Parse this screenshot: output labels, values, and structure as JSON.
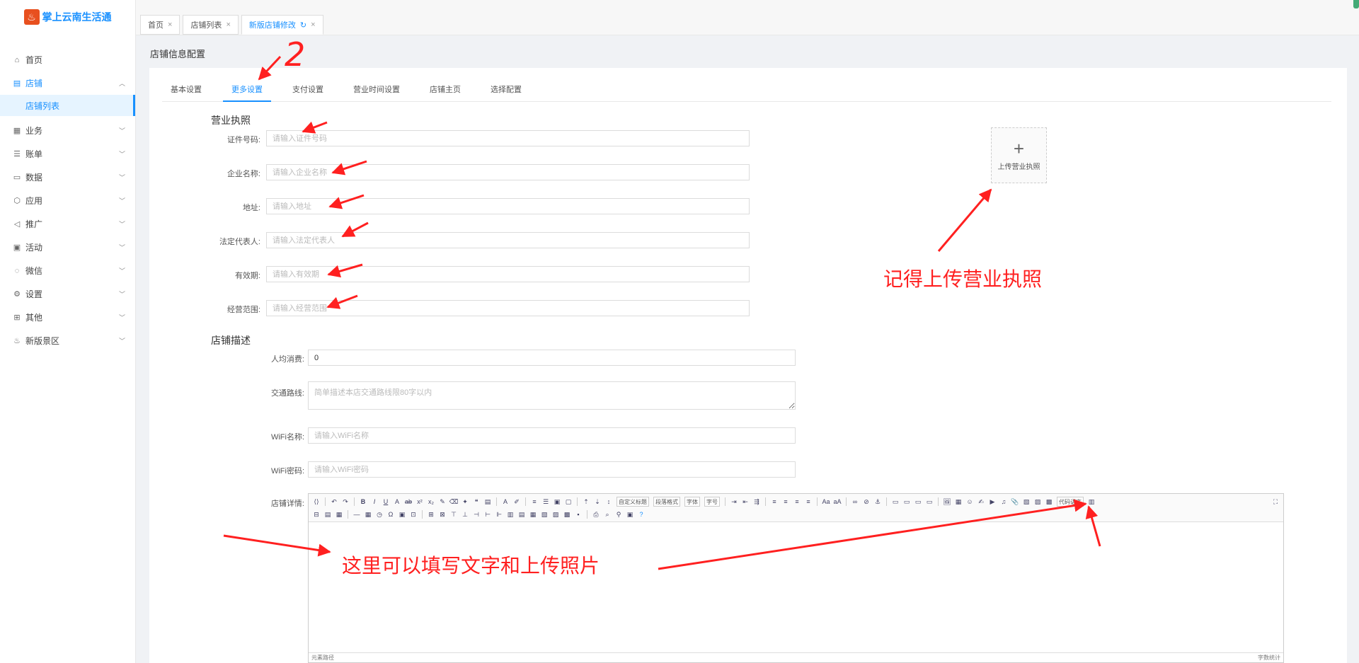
{
  "app": {
    "logo_text": "掌上云南生活通",
    "logo_icon": "flame-logo-icon"
  },
  "sidebar": {
    "items": [
      {
        "label": "首页",
        "icon": "home-icon"
      },
      {
        "label": "店铺",
        "icon": "shop-icon",
        "active": true,
        "expanded": true
      },
      {
        "label": "业务",
        "icon": "business-icon"
      },
      {
        "label": "账单",
        "icon": "bill-icon"
      },
      {
        "label": "数据",
        "icon": "data-icon"
      },
      {
        "label": "应用",
        "icon": "app-icon"
      },
      {
        "label": "推广",
        "icon": "megaphone-icon"
      },
      {
        "label": "活动",
        "icon": "activity-icon"
      },
      {
        "label": "微信",
        "icon": "wechat-icon"
      },
      {
        "label": "设置",
        "icon": "gear-icon"
      },
      {
        "label": "其他",
        "icon": "grid-icon"
      },
      {
        "label": "新版景区",
        "icon": "scenic-icon"
      }
    ],
    "submenu": {
      "label": "店铺列表"
    }
  },
  "tabs": [
    {
      "label": "首页",
      "active": false
    },
    {
      "label": "店铺列表",
      "active": false
    },
    {
      "label": "新版店铺修改",
      "active": true
    }
  ],
  "page": {
    "title": "店铺信息配置"
  },
  "inner_tabs": [
    {
      "label": "基本设置",
      "active": false
    },
    {
      "label": "更多设置",
      "active": true
    },
    {
      "label": "支付设置",
      "active": false
    },
    {
      "label": "营业时间设置",
      "active": false
    },
    {
      "label": "店铺主页",
      "active": false
    },
    {
      "label": "选择配置",
      "active": false
    }
  ],
  "license": {
    "section_title": "营业执照",
    "fields": [
      {
        "label": "证件号码:",
        "placeholder": "请输入证件号码",
        "value": ""
      },
      {
        "label": "企业名称:",
        "placeholder": "请输入企业名称",
        "value": ""
      },
      {
        "label": "地址:",
        "placeholder": "请输入地址",
        "value": ""
      },
      {
        "label": "法定代表人:",
        "placeholder": "请输入法定代表人",
        "value": ""
      },
      {
        "label": "有效期:",
        "placeholder": "请输入有效期",
        "value": ""
      },
      {
        "label": "经营范围:",
        "placeholder": "请输入经营范围",
        "value": ""
      }
    ],
    "upload_label": "上传营业执照"
  },
  "shop_desc": {
    "section_title": "店铺描述",
    "avg_spend": {
      "label": "人均消费:",
      "value": "0"
    },
    "traffic": {
      "label": "交通路线:",
      "placeholder": "简单描述本店交通路线限80字以内"
    },
    "wifi_name": {
      "label": "WiFi名称:",
      "placeholder": "请输入WiFi名称"
    },
    "wifi_pwd": {
      "label": "WiFi密码:",
      "placeholder": "请输入WiFi密码"
    },
    "detail_label": "店铺详情:"
  },
  "editor": {
    "selects": [
      "自定义标题",
      "段落格式",
      "字体",
      "字号",
      "代码语言"
    ],
    "status_left": "元素路径",
    "status_right": "字数统计"
  },
  "annotations": {
    "step_number": "2",
    "upload_note": "记得上传营业执照",
    "editor_note": "这里可以填写文字和上传照片",
    "color": "#ff2020"
  }
}
